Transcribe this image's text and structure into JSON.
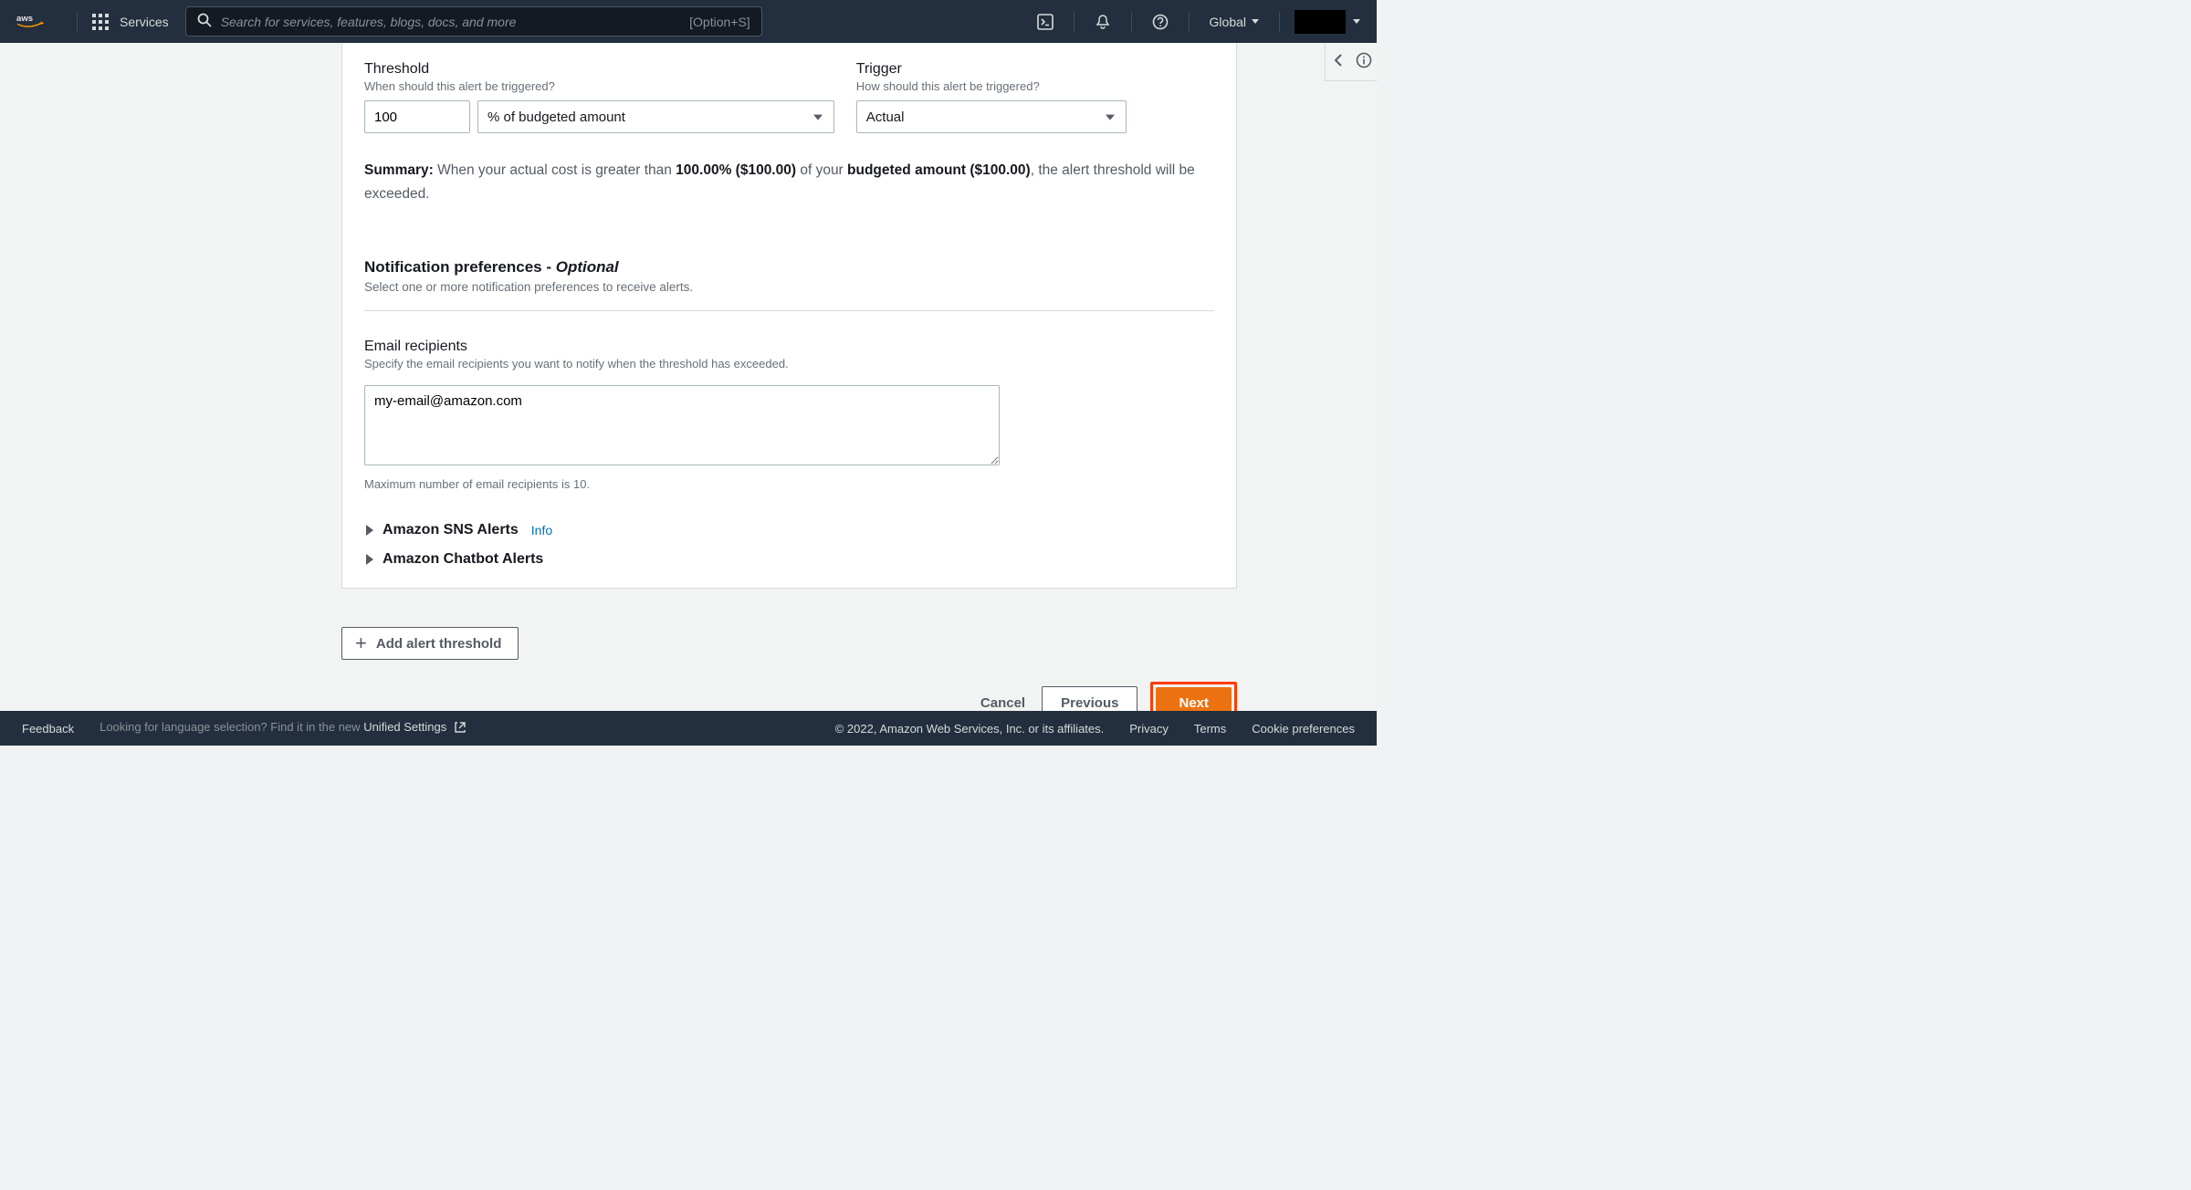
{
  "header": {
    "services_label": "Services",
    "search_placeholder": "Search for services, features, blogs, docs, and more",
    "search_shortcut": "[Option+S]",
    "region": "Global"
  },
  "threshold": {
    "label": "Threshold",
    "help": "When should this alert be triggered?",
    "value": "100",
    "unit": "% of budgeted amount"
  },
  "trigger": {
    "label": "Trigger",
    "help": "How should this alert be triggered?",
    "value": "Actual"
  },
  "summary": {
    "prefix": "Summary:",
    "part1": " When your actual cost is greater than ",
    "percent": "100.00% ($100.00)",
    "part2": " of your ",
    "budget": "budgeted amount ($100.00)",
    "part3": ", the alert threshold will be exceeded."
  },
  "notif": {
    "title": "Notification preferences - ",
    "optional": "Optional",
    "subtitle": "Select one or more notification preferences to receive alerts."
  },
  "email": {
    "label": "Email recipients",
    "help": "Specify the email recipients you want to notify when the threshold has exceeded.",
    "value": "my-email@amazon.com",
    "hint": "Maximum number of email recipients is 10."
  },
  "expanders": {
    "sns": "Amazon SNS Alerts",
    "sns_info": "Info",
    "chatbot": "Amazon Chatbot Alerts"
  },
  "add_button": "Add alert threshold",
  "wizard": {
    "cancel": "Cancel",
    "previous": "Previous",
    "next": "Next"
  },
  "footer": {
    "feedback": "Feedback",
    "lang_prompt": "Looking for language selection? Find it in the new ",
    "unified": "Unified Settings",
    "copyright": "© 2022, Amazon Web Services, Inc. or its affiliates.",
    "privacy": "Privacy",
    "terms": "Terms",
    "cookie": "Cookie preferences"
  }
}
